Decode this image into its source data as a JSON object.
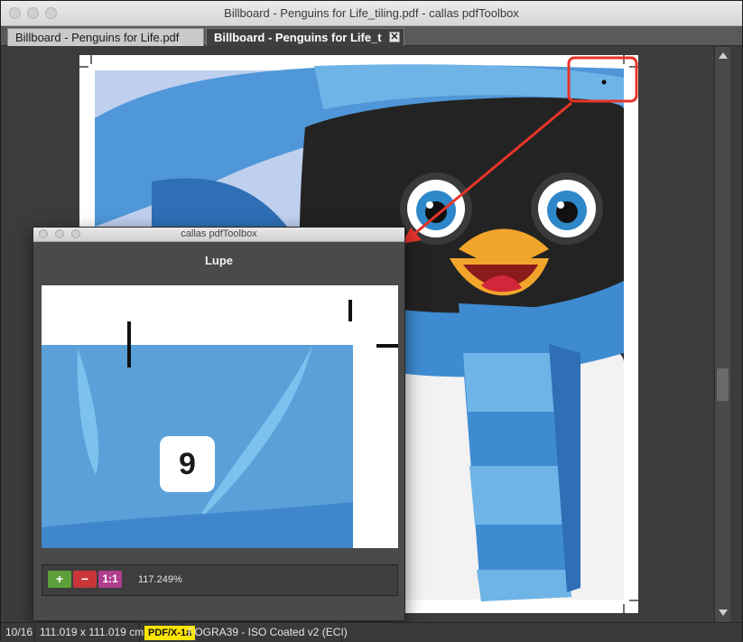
{
  "window": {
    "title": "Billboard - Penguins for Life_tiling.pdf - callas pdfToolbox"
  },
  "tabs": [
    {
      "label": "Billboard - Penguins for Life.pdf",
      "active": false
    },
    {
      "label": "Billboard - Penguins for Life_t",
      "active": true
    }
  ],
  "tab_close_glyph": "✕",
  "statusbar": {
    "page": "10/16",
    "dimensions": "111.019 x 111.019 cm",
    "standard_badge": "PDF/X-1a",
    "color_profile": "FOGRA39 - ISO Coated v2 (ECI)"
  },
  "lupe": {
    "window_title": "callas pdfToolbox",
    "heading": "Lupe",
    "tile_number": "9",
    "zoom_in_label": "+",
    "zoom_out_label": "−",
    "actual_size_label": "1:1",
    "zoom_value": "117.249%"
  },
  "colors": {
    "highlight": "#e8342a",
    "zoom_in": "#5da03a",
    "zoom_out": "#c8363a",
    "actual_size": "#b13d8e",
    "sky": "#bfcfee",
    "scarf_blue": "#3f8bd1",
    "scarf_light": "#6fb4e6"
  },
  "icons": {
    "arrow_up": "triangle-up",
    "arrow_down": "triangle-down"
  }
}
